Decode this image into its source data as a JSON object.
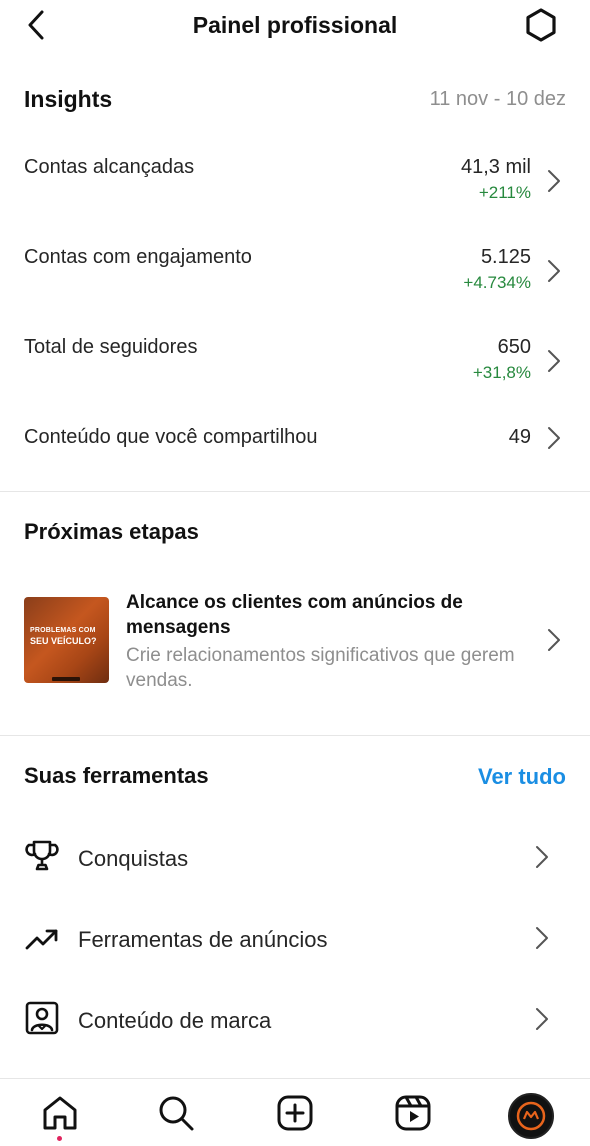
{
  "header": {
    "title": "Painel profissional",
    "back_icon": "chevron-left-icon",
    "settings_icon": "settings-icon"
  },
  "insights": {
    "title": "Insights",
    "date_range": "11 nov - 10 dez",
    "metrics": [
      {
        "label": "Contas alcançadas",
        "value": "41,3 mil",
        "delta": "+211%"
      },
      {
        "label": "Contas com engajamento",
        "value": "5.125",
        "delta": "+4.734%"
      },
      {
        "label": "Total de seguidores",
        "value": "650",
        "delta": "+31,8%"
      },
      {
        "label": "Conteúdo que você compartilhou",
        "value": "49"
      }
    ]
  },
  "next_steps": {
    "title": "Próximas etapas",
    "card": {
      "title": "Alcance os clientes com anúncios de mensagens",
      "description": "Crie relacionamentos significativos que gerem vendas.",
      "thumbnail": {
        "line1": "PROBLEMAS COM",
        "line2": "SEU VEÍCULO?"
      }
    }
  },
  "tools": {
    "title": "Suas ferramentas",
    "see_all": "Ver tudo",
    "items": [
      {
        "label": "Conquistas",
        "icon": "trophy-icon"
      },
      {
        "label": "Ferramentas de anúncios",
        "icon": "trending-up-icon"
      },
      {
        "label": "Conteúdo de marca",
        "icon": "branded-content-icon"
      }
    ]
  },
  "bottom_nav": {
    "items": [
      "home-icon",
      "search-icon",
      "create-icon",
      "reels-icon",
      "profile-avatar"
    ]
  },
  "colors": {
    "positive": "#27893e",
    "accent": "#1a8ee3",
    "muted": "#8e8e8e",
    "notification_dot": "#e0245e"
  }
}
